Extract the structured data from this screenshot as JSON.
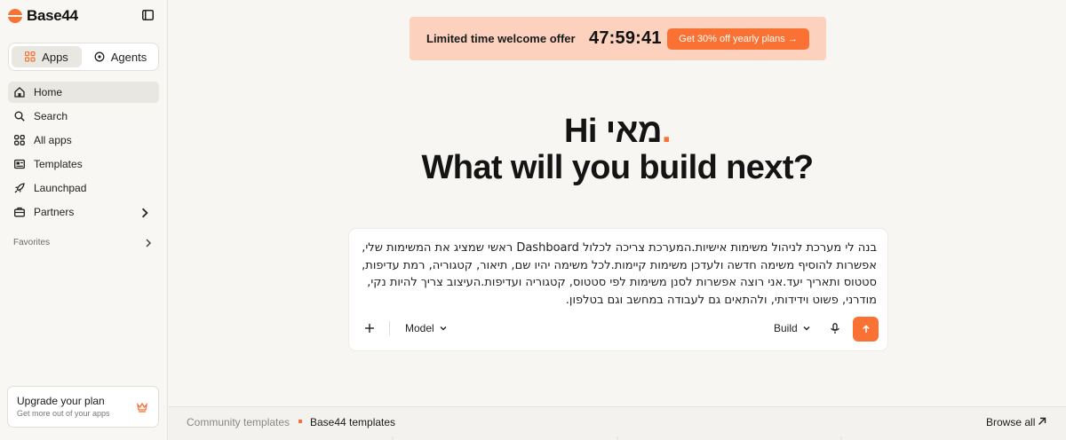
{
  "sidebar": {
    "brand": "Base44",
    "tabs": [
      {
        "label": "Apps",
        "icon": "apps-grid-icon",
        "active": true
      },
      {
        "label": "Agents",
        "icon": "agent-icon",
        "active": false
      }
    ],
    "nav": [
      {
        "label": "Home",
        "icon": "home-icon",
        "active": true
      },
      {
        "label": "Search",
        "icon": "search-icon"
      },
      {
        "label": "All apps",
        "icon": "grid-icon"
      },
      {
        "label": "Templates",
        "icon": "templates-icon"
      },
      {
        "label": "Launchpad",
        "icon": "rocket-icon"
      },
      {
        "label": "Partners",
        "icon": "briefcase-icon",
        "chevron": true
      }
    ],
    "favorites_label": "Favorites",
    "upgrade": {
      "title": "Upgrade your plan",
      "subtitle": "Get more out of your apps",
      "icon": "crown-icon"
    }
  },
  "offer": {
    "text": "Limited time welcome offer",
    "timer": "47:59:41",
    "button": "Get 30% off yearly plans →"
  },
  "hero": {
    "greeting_prefix": "Hi ",
    "name": "מאי",
    "dot": ".",
    "subtitle": "What will you build next?"
  },
  "prompt": {
    "text": "בנה לי מערכת לניהול משימות אישיות.המערכת צריכה לכלול Dashboard ראשי שמציג את המשימות שלי, אפשרות להוסיף משימה חדשה ולעדכן משימות קיימות.לכל משימה יהיו שם, תיאור, קטגוריה, רמת עדיפות, סטטוס ותאריך יעד.אני רוצה אפשרות לסנן משימות לפי סטטוס, קטגוריה ועדיפות.העיצוב צריך להיות נקי, מודרני, פשוט וידידותי, ולהתאים גם לעבודה במחשב וגם בטלפון.",
    "model_label": "Model",
    "build_label": "Build"
  },
  "bottom": {
    "community": "Community templates",
    "base44": "Base44 templates",
    "browse": "Browse all"
  },
  "colors": {
    "accent": "#f97234",
    "offer_bg": "#fcd2be",
    "page_bg": "#f7f6f2"
  }
}
